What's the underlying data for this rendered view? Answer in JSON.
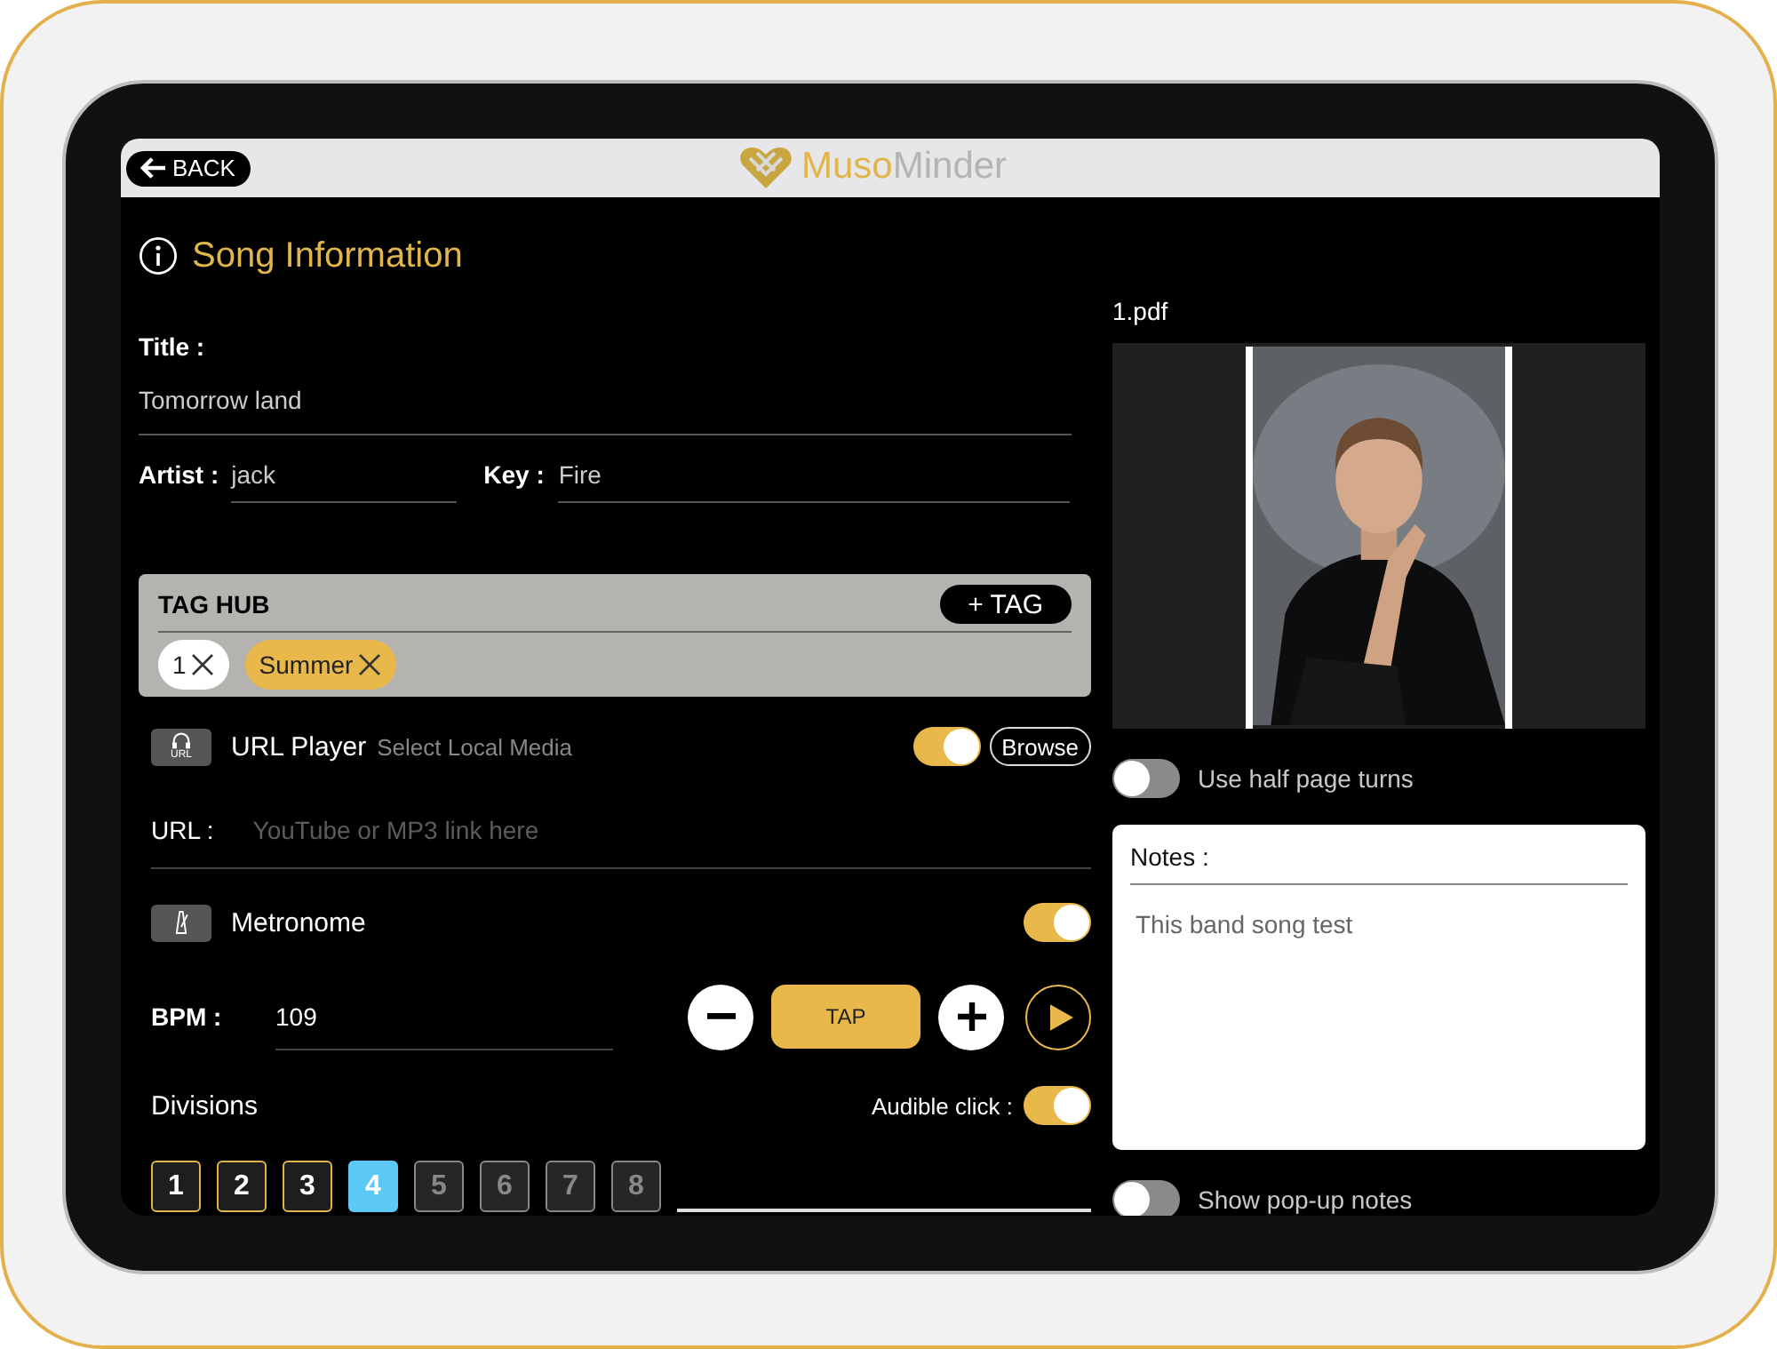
{
  "header": {
    "back": "BACK",
    "logo": [
      "Muso",
      "Minder"
    ]
  },
  "song_info": {
    "heading": "Song Information",
    "title": {
      "label": "Title :",
      "value": "Tomorrow land"
    },
    "artist": {
      "label": "Artist :",
      "value": "jack"
    },
    "key": {
      "label": "Key :",
      "value": "Fire"
    }
  },
  "tag_hub": {
    "title": "TAG HUB",
    "add_button": "+ TAG",
    "tags": [
      {
        "label": "1",
        "color": "#ffffff"
      },
      {
        "label": "Summer",
        "color": "#e8b84a"
      }
    ]
  },
  "url_player": {
    "icon_label": "URL",
    "label": "URL Player",
    "link": "Select Local Media",
    "on": true,
    "browse": "Browse",
    "url_label": "URL :",
    "url_placeholder": "YouTube or MP3 link here"
  },
  "metronome": {
    "label": "Metronome",
    "on": true,
    "bpm_label": "BPM :",
    "bpm": "109",
    "tap": "TAP",
    "divisions_label": "Divisions",
    "audible_label": "Audible click :",
    "audible_on": true,
    "divisions": [
      {
        "label": "1",
        "selected": false,
        "disabled": false
      },
      {
        "label": "2",
        "selected": false,
        "disabled": false
      },
      {
        "label": "3",
        "selected": false,
        "disabled": false
      },
      {
        "label": "4",
        "selected": true,
        "disabled": false
      },
      {
        "label": "5",
        "selected": false,
        "disabled": true
      },
      {
        "label": "6",
        "selected": false,
        "disabled": true
      },
      {
        "label": "7",
        "selected": false,
        "disabled": true
      },
      {
        "label": "8",
        "selected": false,
        "disabled": true
      }
    ]
  },
  "pdf": {
    "file": "1.pdf",
    "half_page_label": "Use half page turns",
    "half_page_on": false,
    "notes_label": "Notes :",
    "notes": "This band song test",
    "popup_label": "Show pop-up notes",
    "popup_on": false
  }
}
